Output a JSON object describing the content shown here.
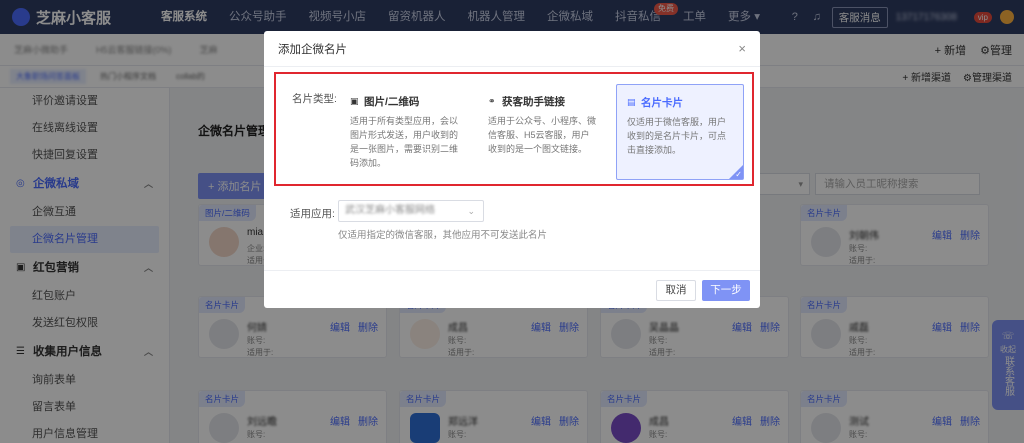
{
  "app": {
    "name": "芝麻小客服"
  },
  "topnav": {
    "items": [
      "客服系统",
      "公众号助手",
      "视频号小店",
      "留资机器人",
      "机器人管理",
      "企微私域",
      "抖音私信",
      "工单",
      "更多"
    ],
    "badge_free": "免费",
    "message_button": "客服消息",
    "account": "13717176308",
    "vip": "vip"
  },
  "tabbar": {
    "tabs": [
      "芝麻小微助手",
      "H5云客服链接(0%)",
      "芝麻"
    ],
    "new_label": "+ 新增",
    "manage_label": "管理"
  },
  "subtabs": {
    "tabs": [
      "大象职场问答面板",
      "热门小程序文档",
      "collab的"
    ],
    "new_channel": "+ 新增渠道",
    "manage_channel": "管理渠道"
  },
  "sidebar": {
    "items_top": [
      "评价邀请设置",
      "在线离线设置",
      "快捷回复设置"
    ],
    "group_wecom": "企微私域",
    "wecom_items": [
      "企微互通",
      "企微名片管理"
    ],
    "group_redpacket": "红包营销",
    "redpacket_items": [
      "红包账户",
      "发送红包权限"
    ],
    "group_collect": "收集用户信息",
    "collect_items": [
      "询前表单",
      "留言表单",
      "用户信息管理"
    ]
  },
  "main": {
    "title": "企微名片管理",
    "add_button": "+ 添加名片",
    "search_placeholder": "请输入员工昵称搜索",
    "cards": [
      {
        "tag": "图片/二维码",
        "name": "mia",
        "line1": "企业: ",
        "line2": "适用于: "
      },
      {
        "tag": "名片卡片",
        "name": "刘朝伟",
        "line1": "账号: ",
        "line2": "适用于: "
      },
      {
        "tag": "名片卡片",
        "name": "何婧",
        "line1": "账号: ",
        "line2": "适用于: "
      },
      {
        "tag": "名片卡片",
        "name": "成昌",
        "line1": "账号: ",
        "line2": "适用于: "
      },
      {
        "tag": "名片卡片",
        "name": "吴晶晶",
        "line1": "账号: ",
        "line2": "适用于: "
      },
      {
        "tag": "名片卡片",
        "name": "戚磊",
        "line1": "账号: ",
        "line2": "适用于: "
      },
      {
        "tag": "名片卡片",
        "name": "刘远瞻",
        "line1": "账号: ",
        "line2": ""
      },
      {
        "tag": "名片卡片",
        "name": "郑远洋",
        "line1": "账号: ",
        "line2": ""
      },
      {
        "tag": "名片卡片",
        "name": "成昌",
        "line1": "账号: ",
        "line2": ""
      },
      {
        "tag": "名片卡片",
        "name": "测试",
        "line1": "账号: ",
        "line2": ""
      }
    ],
    "edit": "编辑",
    "delete": "删除"
  },
  "float_contact": "联系客服",
  "float_fold": "收起",
  "modal": {
    "title": "添加企微名片",
    "close": "×",
    "type_label": "名片类型:",
    "options": [
      {
        "title": "图片/二维码",
        "desc": "适用于所有类型应用，会以图片形式发送，用户收到的是一张图片，需要识别二维码添加。"
      },
      {
        "title": "获客助手链接",
        "desc": "适用于公众号、小程序、微信客服、H5云客服，用户收到的是一个图文链接。"
      },
      {
        "title": "名片卡片",
        "desc": "仅适用于微信客服，用户收到的是名片卡片，可点击直接添加。"
      }
    ],
    "app_label": "适用应用:",
    "app_value": "武汉芝麻小客服网络",
    "app_hint": "仅适用指定的微信客服，其他应用不可发送此名片",
    "cancel": "取消",
    "next": "下一步"
  },
  "colors": {
    "accent": "#4b6cff",
    "topbar": "#2f3d63",
    "highlight": "#e0262f"
  }
}
